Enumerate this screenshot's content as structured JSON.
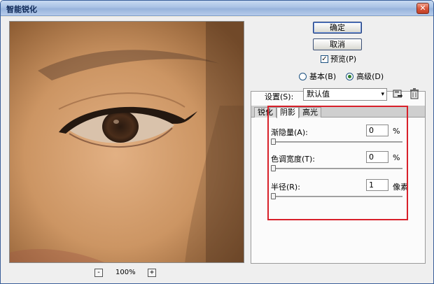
{
  "window": {
    "title": "智能锐化",
    "close_symbol": "✕"
  },
  "zoom": {
    "minus": "-",
    "level": "100%",
    "plus": "+"
  },
  "buttons": {
    "ok": "确定",
    "cancel": "取消"
  },
  "preview_check": {
    "label": "预览(P)",
    "checked": true,
    "check_mark": "✓"
  },
  "mode": {
    "basic": "基本(B)",
    "advanced": "高级(D)",
    "selected": "advanced"
  },
  "settings": {
    "label": "设置(S):",
    "value": "默认值",
    "arrow": "▾"
  },
  "tabs": [
    {
      "label": "锐化",
      "active": false
    },
    {
      "label": "阴影",
      "active": true
    },
    {
      "label": "高光",
      "active": false
    }
  ],
  "params": {
    "fade": {
      "label": "渐隐量(A):",
      "value": "0",
      "unit": "%",
      "level": 0
    },
    "tonal": {
      "label": "色调宽度(T):",
      "value": "0",
      "unit": "%",
      "level": 0
    },
    "radius": {
      "label": "半径(R):",
      "value": "1",
      "unit": "像素",
      "level": 0
    }
  },
  "colors": {
    "highlight_frame": "#d8202a",
    "title_bar": "#a9c2e4"
  }
}
